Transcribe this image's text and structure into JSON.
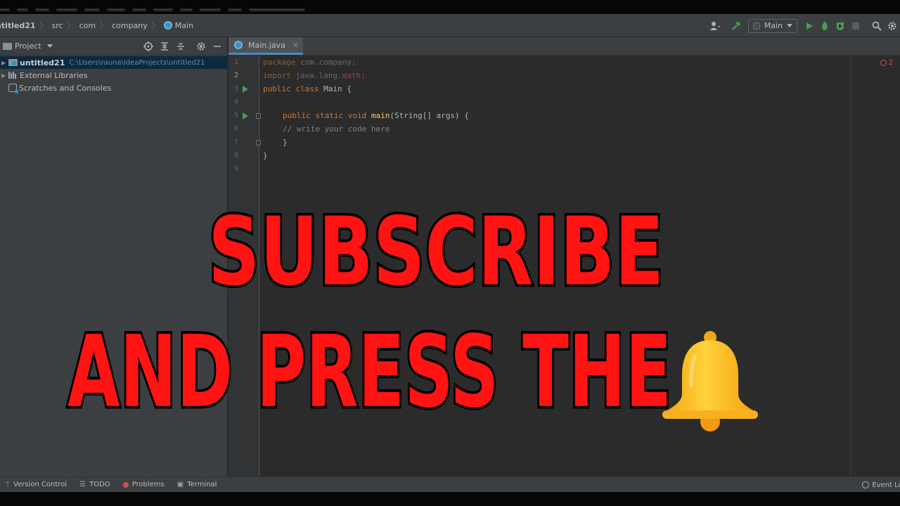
{
  "navbar": {
    "breadcrumbs": [
      "ntitled21",
      "src",
      "com",
      "company",
      "Main"
    ],
    "run_config": "Main"
  },
  "project_panel": {
    "title": "Project",
    "tree": [
      {
        "label": "untitled21",
        "path": "C:\\Users\\rauna\\IdeaProjects\\untitled21",
        "selected": true
      },
      {
        "label": "External Libraries"
      },
      {
        "label": "Scratches and Consoles"
      }
    ]
  },
  "editor": {
    "tab": "Main.java",
    "error_count": "2",
    "line_numbers": [
      "1",
      "2",
      "3",
      "4",
      "5",
      "6",
      "7",
      "8",
      "9"
    ],
    "code": {
      "l1_kw": "package",
      "l1_rest": " com.company;",
      "l2_kw": "import",
      "l2_rest": " java.lang.",
      "l2_err": "math",
      "l2_end": ";",
      "l3_kw": "public class",
      "l3_rest": " Main {",
      "l5_kw": "public static void",
      "l5_fn": " main",
      "l5_rest": "(String[] args) {",
      "l6": "// write your code here",
      "l7": "}",
      "l8": "}"
    }
  },
  "statusbar": {
    "items": [
      "Version Control",
      "TODO",
      "Problems",
      "Terminal"
    ],
    "right": "Event Log"
  },
  "overlay": {
    "line1": "SUBSCRIBE",
    "line2": "AND PRESS THE",
    "bell_icon": "bell-icon",
    "text_color": "#ff1313"
  }
}
